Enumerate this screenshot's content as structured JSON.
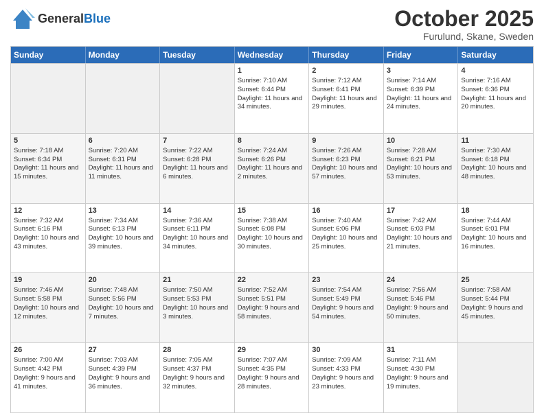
{
  "header": {
    "logo_line1": "General",
    "logo_line2": "Blue",
    "month_title": "October 2025",
    "location": "Furulund, Skane, Sweden"
  },
  "days_of_week": [
    "Sunday",
    "Monday",
    "Tuesday",
    "Wednesday",
    "Thursday",
    "Friday",
    "Saturday"
  ],
  "weeks": [
    [
      {
        "day": "",
        "sunrise": "",
        "sunset": "",
        "daylight": "",
        "empty": true
      },
      {
        "day": "",
        "sunrise": "",
        "sunset": "",
        "daylight": "",
        "empty": true
      },
      {
        "day": "",
        "sunrise": "",
        "sunset": "",
        "daylight": "",
        "empty": true
      },
      {
        "day": "1",
        "sunrise": "Sunrise: 7:10 AM",
        "sunset": "Sunset: 6:44 PM",
        "daylight": "Daylight: 11 hours and 34 minutes.",
        "empty": false
      },
      {
        "day": "2",
        "sunrise": "Sunrise: 7:12 AM",
        "sunset": "Sunset: 6:41 PM",
        "daylight": "Daylight: 11 hours and 29 minutes.",
        "empty": false
      },
      {
        "day": "3",
        "sunrise": "Sunrise: 7:14 AM",
        "sunset": "Sunset: 6:39 PM",
        "daylight": "Daylight: 11 hours and 24 minutes.",
        "empty": false
      },
      {
        "day": "4",
        "sunrise": "Sunrise: 7:16 AM",
        "sunset": "Sunset: 6:36 PM",
        "daylight": "Daylight: 11 hours and 20 minutes.",
        "empty": false
      }
    ],
    [
      {
        "day": "5",
        "sunrise": "Sunrise: 7:18 AM",
        "sunset": "Sunset: 6:34 PM",
        "daylight": "Daylight: 11 hours and 15 minutes.",
        "empty": false
      },
      {
        "day": "6",
        "sunrise": "Sunrise: 7:20 AM",
        "sunset": "Sunset: 6:31 PM",
        "daylight": "Daylight: 11 hours and 11 minutes.",
        "empty": false
      },
      {
        "day": "7",
        "sunrise": "Sunrise: 7:22 AM",
        "sunset": "Sunset: 6:28 PM",
        "daylight": "Daylight: 11 hours and 6 minutes.",
        "empty": false
      },
      {
        "day": "8",
        "sunrise": "Sunrise: 7:24 AM",
        "sunset": "Sunset: 6:26 PM",
        "daylight": "Daylight: 11 hours and 2 minutes.",
        "empty": false
      },
      {
        "day": "9",
        "sunrise": "Sunrise: 7:26 AM",
        "sunset": "Sunset: 6:23 PM",
        "daylight": "Daylight: 10 hours and 57 minutes.",
        "empty": false
      },
      {
        "day": "10",
        "sunrise": "Sunrise: 7:28 AM",
        "sunset": "Sunset: 6:21 PM",
        "daylight": "Daylight: 10 hours and 53 minutes.",
        "empty": false
      },
      {
        "day": "11",
        "sunrise": "Sunrise: 7:30 AM",
        "sunset": "Sunset: 6:18 PM",
        "daylight": "Daylight: 10 hours and 48 minutes.",
        "empty": false
      }
    ],
    [
      {
        "day": "12",
        "sunrise": "Sunrise: 7:32 AM",
        "sunset": "Sunset: 6:16 PM",
        "daylight": "Daylight: 10 hours and 43 minutes.",
        "empty": false
      },
      {
        "day": "13",
        "sunrise": "Sunrise: 7:34 AM",
        "sunset": "Sunset: 6:13 PM",
        "daylight": "Daylight: 10 hours and 39 minutes.",
        "empty": false
      },
      {
        "day": "14",
        "sunrise": "Sunrise: 7:36 AM",
        "sunset": "Sunset: 6:11 PM",
        "daylight": "Daylight: 10 hours and 34 minutes.",
        "empty": false
      },
      {
        "day": "15",
        "sunrise": "Sunrise: 7:38 AM",
        "sunset": "Sunset: 6:08 PM",
        "daylight": "Daylight: 10 hours and 30 minutes.",
        "empty": false
      },
      {
        "day": "16",
        "sunrise": "Sunrise: 7:40 AM",
        "sunset": "Sunset: 6:06 PM",
        "daylight": "Daylight: 10 hours and 25 minutes.",
        "empty": false
      },
      {
        "day": "17",
        "sunrise": "Sunrise: 7:42 AM",
        "sunset": "Sunset: 6:03 PM",
        "daylight": "Daylight: 10 hours and 21 minutes.",
        "empty": false
      },
      {
        "day": "18",
        "sunrise": "Sunrise: 7:44 AM",
        "sunset": "Sunset: 6:01 PM",
        "daylight": "Daylight: 10 hours and 16 minutes.",
        "empty": false
      }
    ],
    [
      {
        "day": "19",
        "sunrise": "Sunrise: 7:46 AM",
        "sunset": "Sunset: 5:58 PM",
        "daylight": "Daylight: 10 hours and 12 minutes.",
        "empty": false
      },
      {
        "day": "20",
        "sunrise": "Sunrise: 7:48 AM",
        "sunset": "Sunset: 5:56 PM",
        "daylight": "Daylight: 10 hours and 7 minutes.",
        "empty": false
      },
      {
        "day": "21",
        "sunrise": "Sunrise: 7:50 AM",
        "sunset": "Sunset: 5:53 PM",
        "daylight": "Daylight: 10 hours and 3 minutes.",
        "empty": false
      },
      {
        "day": "22",
        "sunrise": "Sunrise: 7:52 AM",
        "sunset": "Sunset: 5:51 PM",
        "daylight": "Daylight: 9 hours and 58 minutes.",
        "empty": false
      },
      {
        "day": "23",
        "sunrise": "Sunrise: 7:54 AM",
        "sunset": "Sunset: 5:49 PM",
        "daylight": "Daylight: 9 hours and 54 minutes.",
        "empty": false
      },
      {
        "day": "24",
        "sunrise": "Sunrise: 7:56 AM",
        "sunset": "Sunset: 5:46 PM",
        "daylight": "Daylight: 9 hours and 50 minutes.",
        "empty": false
      },
      {
        "day": "25",
        "sunrise": "Sunrise: 7:58 AM",
        "sunset": "Sunset: 5:44 PM",
        "daylight": "Daylight: 9 hours and 45 minutes.",
        "empty": false
      }
    ],
    [
      {
        "day": "26",
        "sunrise": "Sunrise: 7:00 AM",
        "sunset": "Sunset: 4:42 PM",
        "daylight": "Daylight: 9 hours and 41 minutes.",
        "empty": false
      },
      {
        "day": "27",
        "sunrise": "Sunrise: 7:03 AM",
        "sunset": "Sunset: 4:39 PM",
        "daylight": "Daylight: 9 hours and 36 minutes.",
        "empty": false
      },
      {
        "day": "28",
        "sunrise": "Sunrise: 7:05 AM",
        "sunset": "Sunset: 4:37 PM",
        "daylight": "Daylight: 9 hours and 32 minutes.",
        "empty": false
      },
      {
        "day": "29",
        "sunrise": "Sunrise: 7:07 AM",
        "sunset": "Sunset: 4:35 PM",
        "daylight": "Daylight: 9 hours and 28 minutes.",
        "empty": false
      },
      {
        "day": "30",
        "sunrise": "Sunrise: 7:09 AM",
        "sunset": "Sunset: 4:33 PM",
        "daylight": "Daylight: 9 hours and 23 minutes.",
        "empty": false
      },
      {
        "day": "31",
        "sunrise": "Sunrise: 7:11 AM",
        "sunset": "Sunset: 4:30 PM",
        "daylight": "Daylight: 9 hours and 19 minutes.",
        "empty": false
      },
      {
        "day": "",
        "sunrise": "",
        "sunset": "",
        "daylight": "",
        "empty": true
      }
    ]
  ]
}
